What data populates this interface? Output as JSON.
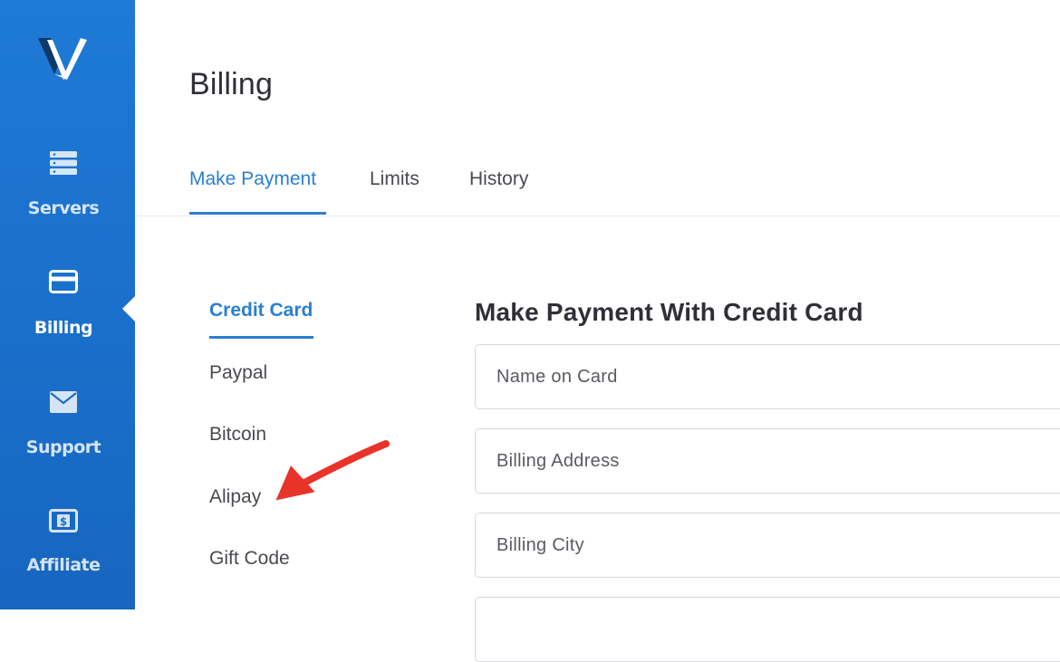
{
  "sidebar": {
    "logo_icon": "v-logo-icon",
    "items": [
      {
        "label": "Servers",
        "icon": "server-stack-icon"
      },
      {
        "label": "Billing",
        "icon": "credit-card-icon",
        "active": true
      },
      {
        "label": "Support",
        "icon": "envelope-icon"
      },
      {
        "label": "Affiliate",
        "icon": "dollar-bill-icon"
      }
    ]
  },
  "page": {
    "title": "Billing"
  },
  "tabs": [
    {
      "label": "Make Payment",
      "active": true
    },
    {
      "label": "Limits"
    },
    {
      "label": "History"
    }
  ],
  "methods": [
    {
      "label": "Credit Card",
      "active": true
    },
    {
      "label": "Paypal"
    },
    {
      "label": "Bitcoin"
    },
    {
      "label": "Alipay"
    },
    {
      "label": "Gift Code"
    }
  ],
  "form": {
    "title": "Make Payment With Credit Card",
    "name_placeholder": "Name on Card",
    "address_placeholder": "Billing Address",
    "city_placeholder": "Billing City",
    "next_placeholder": ""
  },
  "annotation": {
    "icon": "red-arrow-annotation",
    "color": "#e8332a"
  },
  "colors": {
    "sidebar": "#1a6fca",
    "accent": "#2a7fd0"
  }
}
